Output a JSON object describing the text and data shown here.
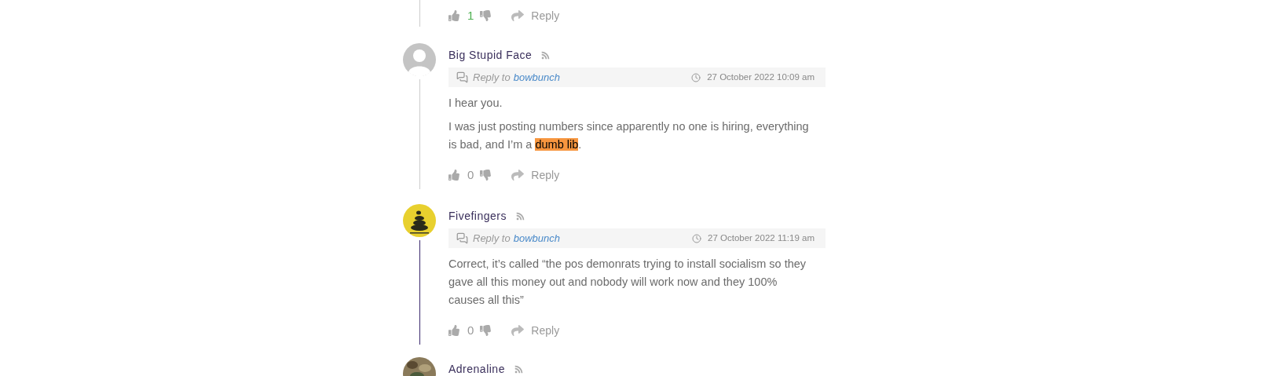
{
  "comments": [
    {
      "kind": "tail",
      "color": "#cccccc",
      "votes": {
        "count": "1",
        "positive": true
      },
      "reply": "Reply"
    },
    {
      "kind": "full",
      "author": "Big Stupid Face",
      "avatar": {
        "kind": "default"
      },
      "color": "#cccccc",
      "meta": {
        "reply_prefix": "Reply to",
        "reply_to": "bowbunch",
        "date": "27 October 2022 10:09 am"
      },
      "paragraphs": [
        [
          {
            "text": "I hear you.",
            "highlighted": false
          }
        ],
        [
          {
            "text": "I was just posting numbers since apparently no one is hiring, everything is bad, and I’m a ",
            "highlighted": false
          },
          {
            "text": "dumb lib",
            "highlighted": true
          },
          {
            "text": ".",
            "highlighted": false
          }
        ]
      ],
      "votes": {
        "count": "0",
        "positive": false
      },
      "reply": "Reply"
    },
    {
      "kind": "full",
      "author": "Fivefingers",
      "avatar": {
        "kind": "picture"
      },
      "color": "#3b2a6e",
      "meta": {
        "reply_prefix": "Reply to",
        "reply_to": "bowbunch",
        "date": "27 October 2022 11:19 am"
      },
      "paragraphs": [
        [
          {
            "text": "Correct, it’s called “the pos demonrats trying to install socialism so they gave all this money out and nobody will work now and they 100% causes all this”",
            "highlighted": false
          }
        ]
      ],
      "votes": {
        "count": "0",
        "positive": false
      },
      "reply": "Reply"
    },
    {
      "kind": "header",
      "author": "Adrenaline",
      "avatar": {
        "kind": "picture"
      }
    }
  ]
}
